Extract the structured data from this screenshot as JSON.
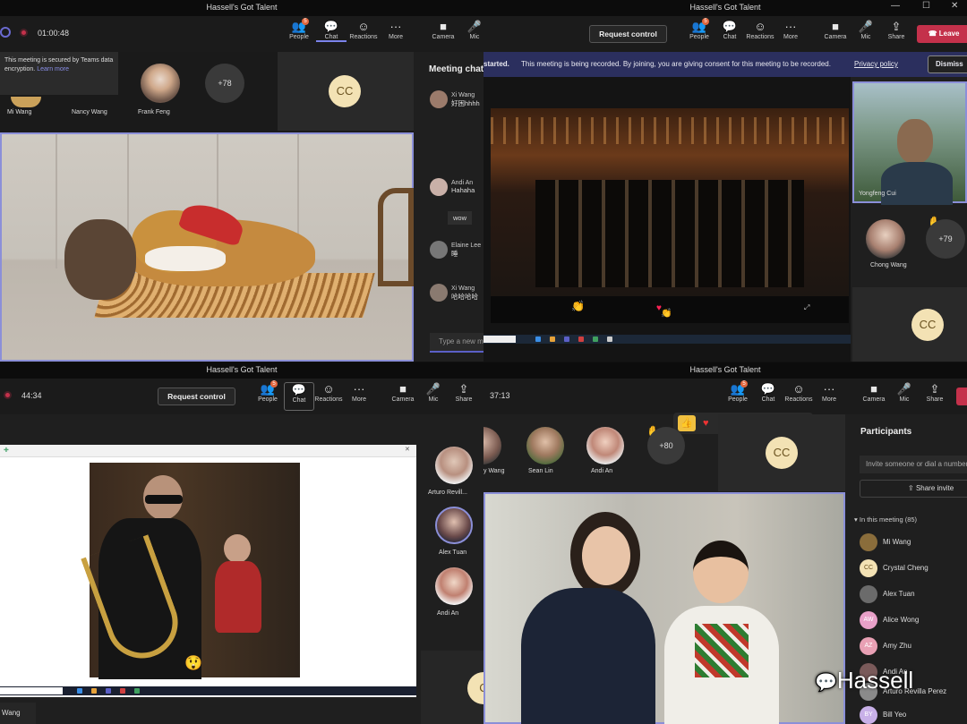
{
  "q1": {
    "title": "Hassell's Got Talent",
    "timer": "01:00:48",
    "toolbar": {
      "people": "People",
      "chat": "Chat",
      "reactions": "Reactions",
      "more": "More",
      "camera": "Camera",
      "mic": "Mic",
      "people_badge": "5"
    },
    "notice": {
      "text": "This meeting is secured by Teams data encryption.",
      "link": "Learn more"
    },
    "participants": [
      {
        "name": "Mi Wang"
      },
      {
        "name": "Nancy Wang"
      },
      {
        "name": "Frank Feng"
      }
    ],
    "more_count": "+78",
    "cc": "CC",
    "chat_title": "Meeting chat",
    "messages": [
      {
        "sender": "Xi Wang",
        "text": "好困hhhh"
      },
      {
        "sender": "Andi An",
        "text": "Hahaha"
      },
      {
        "sender": "",
        "text": "wow"
      },
      {
        "sender": "Elaine Lee",
        "text": "睡"
      },
      {
        "sender": "Xi Wang",
        "text": "哈哈哈哈"
      }
    ],
    "chat_placeholder": "Type a new message"
  },
  "q2": {
    "title": "Hassell's Got Talent",
    "request_control": "Request control",
    "toolbar": {
      "people": "People",
      "chat": "Chat",
      "reactions": "Reactions",
      "more": "More",
      "camera": "Camera",
      "mic": "Mic",
      "share": "Share",
      "people_badge": "5"
    },
    "leave": "Leave",
    "banner": {
      "prefix": "started.",
      "text": "This meeting is being recorded. By joining, you are giving consent for this meeting to be recorded.",
      "link": "Privacy policy",
      "dismiss": "Dismiss"
    },
    "presenter": "Yongfeng Cui",
    "participant": "Chong Wang",
    "more_count": "+79",
    "cc": "CC"
  },
  "q3": {
    "title": "Hassell's Got Talent",
    "timer": "44:34",
    "request_control": "Request control",
    "toolbar": {
      "people": "People",
      "chat": "Chat",
      "reactions": "Reactions",
      "more": "More",
      "camera": "Camera",
      "mic": "Mic",
      "share": "Share",
      "people_badge": "5"
    },
    "participants": [
      {
        "name": "Arturo Revill..."
      },
      {
        "name": "Alex Tuan"
      },
      {
        "name": "Andi An"
      }
    ],
    "bottom_label": "Wang"
  },
  "q4": {
    "title": "Hassell's Got Talent",
    "timer": "37:13",
    "toolbar": {
      "people": "People",
      "chat": "Chat",
      "reactions": "Reactions",
      "more": "More",
      "camera": "Camera",
      "mic": "Mic",
      "share": "Share",
      "people_badge": "5"
    },
    "participants": [
      {
        "name": "y Wang"
      },
      {
        "name": "Sean Lin"
      },
      {
        "name": "Andi An"
      }
    ],
    "more_count": "+80",
    "cc": "CC",
    "panel_title": "Participants",
    "invite_placeholder": "Invite someone or dial a number",
    "share_invite": "Share invite",
    "in_meeting": "In this meeting (85)",
    "people": [
      {
        "initials": "",
        "name": "Mi Wang",
        "color": "#8a6d3b"
      },
      {
        "initials": "CC",
        "name": "Crystal Cheng",
        "color": "#f3e2b4"
      },
      {
        "initials": "",
        "name": "Alex Tuan",
        "color": "#6b6b6b"
      },
      {
        "initials": "AW",
        "name": "Alice Wong",
        "color": "#e8a0c8"
      },
      {
        "initials": "AZ",
        "name": "Amy Zhu",
        "color": "#e8a0b4"
      },
      {
        "initials": "",
        "name": "Andi An",
        "color": "#7a5a5a"
      },
      {
        "initials": "",
        "name": "Arturo Revilla Perez",
        "color": "#8a8a8a"
      },
      {
        "initials": "BY",
        "name": "Bill Yeo",
        "color": "#c8b0e8"
      }
    ],
    "watermark": "Hassell"
  }
}
